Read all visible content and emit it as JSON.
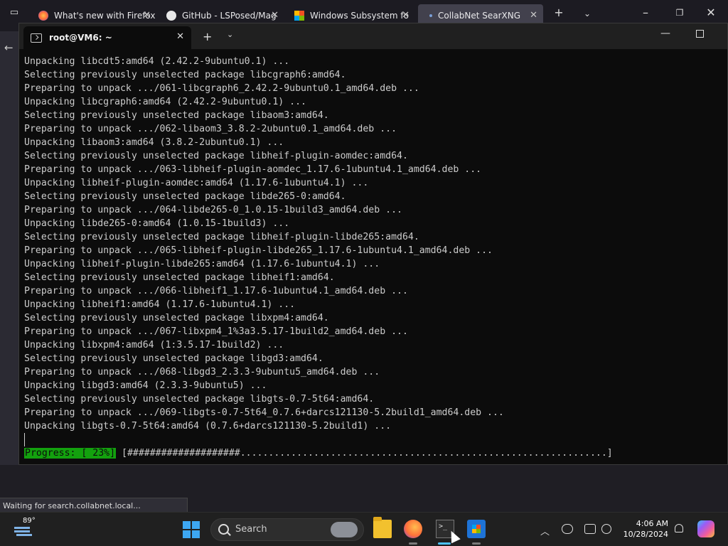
{
  "browser": {
    "tabs": [
      {
        "label": "What's new with Firefox"
      },
      {
        "label": "GitHub - LSPosed/Mag"
      },
      {
        "label": "Windows Subsystem fo"
      },
      {
        "label": "CollabNet SearXNG"
      }
    ],
    "status_text": "Waiting for search.collabnet.local..."
  },
  "terminal": {
    "tab_title": "root@VM6: ~",
    "lines": [
      "Unpacking libcdt5:amd64 (2.42.2-9ubuntu0.1) ...",
      "Selecting previously unselected package libcgraph6:amd64.",
      "Preparing to unpack .../061-libcgraph6_2.42.2-9ubuntu0.1_amd64.deb ...",
      "Unpacking libcgraph6:amd64 (2.42.2-9ubuntu0.1) ...",
      "Selecting previously unselected package libaom3:amd64.",
      "Preparing to unpack .../062-libaom3_3.8.2-2ubuntu0.1_amd64.deb ...",
      "Unpacking libaom3:amd64 (3.8.2-2ubuntu0.1) ...",
      "Selecting previously unselected package libheif-plugin-aomdec:amd64.",
      "Preparing to unpack .../063-libheif-plugin-aomdec_1.17.6-1ubuntu4.1_amd64.deb ...",
      "Unpacking libheif-plugin-aomdec:amd64 (1.17.6-1ubuntu4.1) ...",
      "Selecting previously unselected package libde265-0:amd64.",
      "Preparing to unpack .../064-libde265-0_1.0.15-1build3_amd64.deb ...",
      "Unpacking libde265-0:amd64 (1.0.15-1build3) ...",
      "Selecting previously unselected package libheif-plugin-libde265:amd64.",
      "Preparing to unpack .../065-libheif-plugin-libde265_1.17.6-1ubuntu4.1_amd64.deb ...",
      "Unpacking libheif-plugin-libde265:amd64 (1.17.6-1ubuntu4.1) ...",
      "Selecting previously unselected package libheif1:amd64.",
      "Preparing to unpack .../066-libheif1_1.17.6-1ubuntu4.1_amd64.deb ...",
      "Unpacking libheif1:amd64 (1.17.6-1ubuntu4.1) ...",
      "Selecting previously unselected package libxpm4:amd64.",
      "Preparing to unpack .../067-libxpm4_1%3a3.5.17-1build2_amd64.deb ...",
      "Unpacking libxpm4:amd64 (1:3.5.17-1build2) ...",
      "Selecting previously unselected package libgd3:amd64.",
      "Preparing to unpack .../068-libgd3_2.3.3-9ubuntu5_amd64.deb ...",
      "Unpacking libgd3:amd64 (2.3.3-9ubuntu5) ...",
      "Selecting previously unselected package libgts-0.7-5t64:amd64.",
      "Preparing to unpack .../069-libgts-0.7-5t64_0.7.6+darcs121130-5.2build1_amd64.deb ...",
      "Unpacking libgts-0.7-5t64:amd64 (0.7.6+darcs121130-5.2build1) ..."
    ],
    "progress_label": "Progress: [ 23%]",
    "progress_bar": "[####################.................................................................]",
    "progress_percent": 23
  },
  "taskbar": {
    "temperature": "89°",
    "search_placeholder": "Search",
    "time": "4:06 AM",
    "date": "10/28/2024"
  },
  "colors": {
    "progress_green": "#13a10e",
    "terminal_bg": "#0c0c0c",
    "terminal_fg": "#cccccc"
  }
}
